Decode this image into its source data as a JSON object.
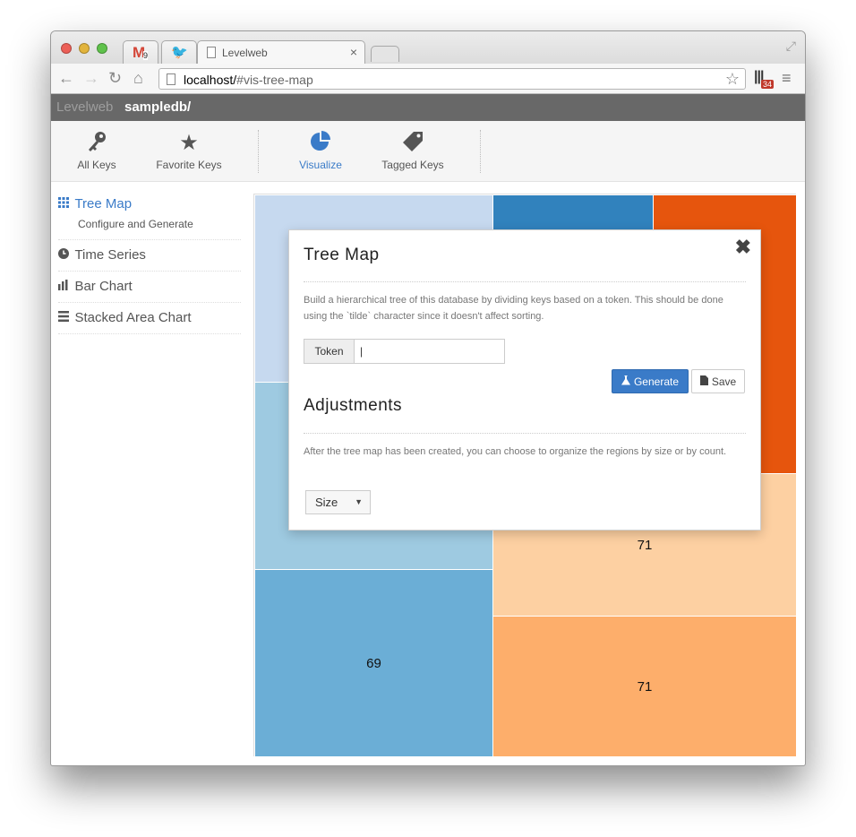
{
  "browser": {
    "tabs": [
      {
        "title": "",
        "badge": "9"
      },
      {
        "title": ""
      },
      {
        "title": "Levelweb",
        "close": "×"
      }
    ],
    "url_host": "localhost/",
    "url_path": "#vis-tree-map",
    "extension_badge": "34"
  },
  "app": {
    "brand": "Levelweb",
    "db": "sampledb/"
  },
  "iconbar": {
    "items": [
      {
        "label": "All Keys",
        "icon": "key-icon"
      },
      {
        "label": "Favorite Keys",
        "icon": "star-icon"
      },
      {
        "label": "Visualize",
        "icon": "pie-chart-icon",
        "active": true
      },
      {
        "label": "Tagged Keys",
        "icon": "tag-icon"
      }
    ]
  },
  "sidebar": {
    "items": [
      {
        "label": "Tree Map",
        "icon": "grid-icon",
        "active": true,
        "sub": "Configure and Generate"
      },
      {
        "label": "Time Series",
        "icon": "clock-icon"
      },
      {
        "label": "Bar Chart",
        "icon": "bar-chart-icon"
      },
      {
        "label": "Stacked Area Chart",
        "icon": "list-icon"
      }
    ]
  },
  "treemap": {
    "cells": [
      {
        "label": "",
        "color": "#c6d9ef"
      },
      {
        "label": "",
        "color": "#3182bd"
      },
      {
        "label": "",
        "color": "#e6550d"
      },
      {
        "label": "",
        "color": "#9ecae1"
      },
      {
        "label": "71",
        "color": "#fdd0a2"
      },
      {
        "label": "69",
        "color": "#6baed6"
      },
      {
        "label": "71",
        "color": "#fdae6b"
      }
    ]
  },
  "modal": {
    "title": "Tree Map",
    "close": "✖",
    "description": "Build a hierarchical tree of this database by dividing keys based on a token. This should be done using the `tilde` character since it doesn't affect sorting.",
    "token_label": "Token",
    "token_value": "|",
    "generate_label": "Generate",
    "save_label": "Save",
    "adjustments_title": "Adjustments",
    "adjustments_description": "After the tree map has been created, you can choose to organize the regions by size or by count.",
    "sort_selected": "Size"
  }
}
